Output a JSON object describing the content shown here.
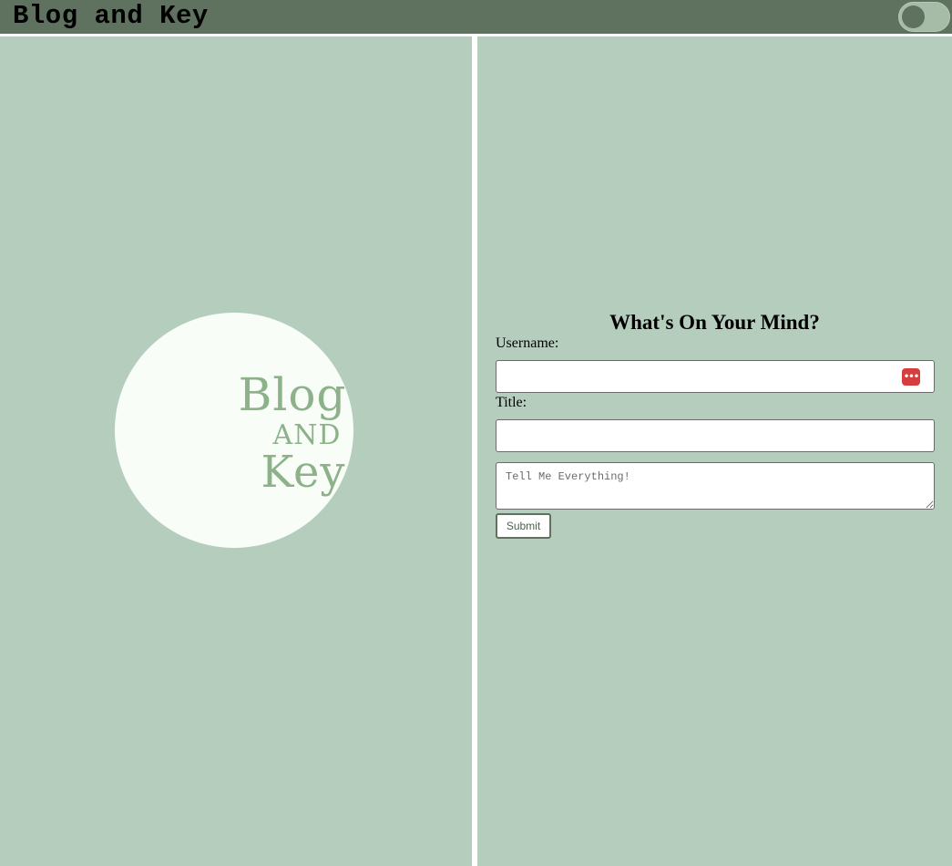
{
  "header": {
    "site_title": "Blog and Key",
    "theme_toggle": {
      "state": "off"
    }
  },
  "logo": {
    "line1": "Blog",
    "line2": "AND",
    "line3": "Key"
  },
  "form": {
    "heading": "What's On Your Mind?",
    "username_label": "Username:",
    "username_value": "",
    "title_label": "Title:",
    "title_value": "",
    "message_placeholder": "Tell Me Everything!",
    "message_value": "",
    "submit_label": "Submit",
    "password_manager_icon": "password-dots-icon"
  },
  "colors": {
    "header_bg": "#5f7260",
    "panel_bg": "#b5cdbd",
    "logo_text": "#8db28a",
    "logo_circle": "#f8fdf8",
    "toggle_bg": "#a7bca7",
    "accent_red": "#d63d3d"
  }
}
